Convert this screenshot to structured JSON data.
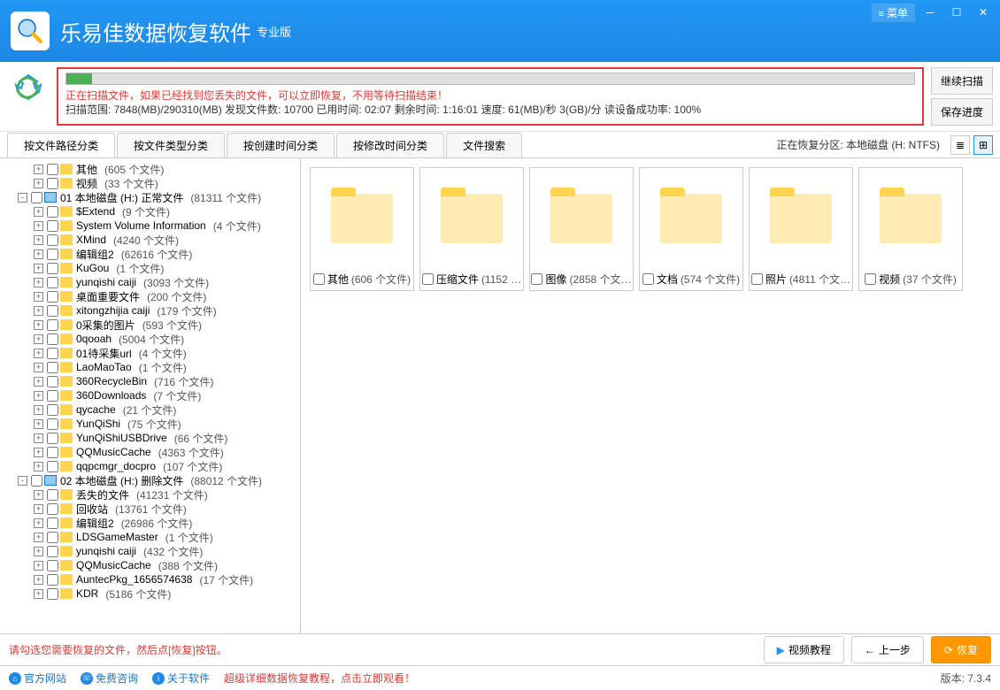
{
  "app": {
    "title": "乐易佳数据恢复软件",
    "subtitle": "专业版",
    "menu_label": "菜单"
  },
  "scan": {
    "msg1": "正在扫描文件，如果已经找到您丢失的文件，可以立即恢复，不用等待扫描结束！",
    "msg2": "扫描范围: 7848(MB)/290310(MB)  发现文件数: 10700  已用时间: 02:07  剩余时间: 1:16:01  速度: 61(MB)/秒  3(GB)/分  读设备成功率: 100%",
    "btn_continue": "继续扫描",
    "btn_save": "保存进度"
  },
  "tabs": [
    "按文件路径分类",
    "按文件类型分类",
    "按创建时间分类",
    "按修改时间分类",
    "文件搜索"
  ],
  "partition_label": "正在恢复分区: 本地磁盘 (H: NTFS)",
  "tree": [
    {
      "level": 2,
      "exp": "+",
      "type": "folder",
      "label": "其他",
      "count": "(605 个文件)"
    },
    {
      "level": 2,
      "exp": "+",
      "type": "folder",
      "label": "视频",
      "count": "(33 个文件)"
    },
    {
      "level": 1,
      "exp": "-",
      "type": "disk",
      "label": "01 本地磁盘 (H:) 正常文件",
      "count": "(81311 个文件)"
    },
    {
      "level": 2,
      "exp": "+",
      "type": "folder",
      "label": "$Extend",
      "count": "(9 个文件)"
    },
    {
      "level": 2,
      "exp": "+",
      "type": "folder",
      "label": "System Volume Information",
      "count": "(4 个文件)"
    },
    {
      "level": 2,
      "exp": "+",
      "type": "folder",
      "label": "XMind",
      "count": "(4240 个文件)"
    },
    {
      "level": 2,
      "exp": "+",
      "type": "folder",
      "label": "编辑组2",
      "count": "(62616 个文件)"
    },
    {
      "level": 2,
      "exp": "+",
      "type": "folder",
      "label": "KuGou",
      "count": "(1 个文件)"
    },
    {
      "level": 2,
      "exp": "+",
      "type": "folder",
      "label": "yunqishi caiji",
      "count": "(3093 个文件)"
    },
    {
      "level": 2,
      "exp": "+",
      "type": "folder",
      "label": "桌面重要文件",
      "count": "(200 个文件)"
    },
    {
      "level": 2,
      "exp": "+",
      "type": "folder",
      "label": "xitongzhijia caiji",
      "count": "(179 个文件)"
    },
    {
      "level": 2,
      "exp": "+",
      "type": "folder",
      "label": "0采集的图片",
      "count": "(593 个文件)"
    },
    {
      "level": 2,
      "exp": "+",
      "type": "folder",
      "label": "0qooah",
      "count": "(5004 个文件)"
    },
    {
      "level": 2,
      "exp": "+",
      "type": "folder",
      "label": "01待采集url",
      "count": "(4 个文件)"
    },
    {
      "level": 2,
      "exp": "+",
      "type": "folder",
      "label": "LaoMaoTao",
      "count": "(1 个文件)"
    },
    {
      "level": 2,
      "exp": "+",
      "type": "folder",
      "label": "360RecycleBin",
      "count": "(716 个文件)"
    },
    {
      "level": 2,
      "exp": "+",
      "type": "folder",
      "label": "360Downloads",
      "count": "(7 个文件)"
    },
    {
      "level": 2,
      "exp": "+",
      "type": "folder",
      "label": "qycache",
      "count": "(21 个文件)"
    },
    {
      "level": 2,
      "exp": "+",
      "type": "folder",
      "label": "YunQiShi",
      "count": "(75 个文件)"
    },
    {
      "level": 2,
      "exp": "+",
      "type": "folder",
      "label": "YunQiShiUSBDrive",
      "count": "(66 个文件)"
    },
    {
      "level": 2,
      "exp": "+",
      "type": "folder",
      "label": "QQMusicCache",
      "count": "(4363 个文件)"
    },
    {
      "level": 2,
      "exp": "+",
      "type": "folder",
      "label": "qqpcmgr_docpro",
      "count": "(107 个文件)"
    },
    {
      "level": 1,
      "exp": "-",
      "type": "disk",
      "label": "02 本地磁盘 (H:) 删除文件",
      "count": "(88012 个文件)"
    },
    {
      "level": 2,
      "exp": "+",
      "type": "folder",
      "label": "丢失的文件",
      "count": "(41231 个文件)"
    },
    {
      "level": 2,
      "exp": "+",
      "type": "folder",
      "label": "回收站",
      "count": "(13761 个文件)"
    },
    {
      "level": 2,
      "exp": "+",
      "type": "folder",
      "label": "编辑组2",
      "count": "(26986 个文件)"
    },
    {
      "level": 2,
      "exp": "+",
      "type": "folder",
      "label": "LDSGameMaster",
      "count": "(1 个文件)"
    },
    {
      "level": 2,
      "exp": "+",
      "type": "folder",
      "label": "yunqishi caiji",
      "count": "(432 个文件)"
    },
    {
      "level": 2,
      "exp": "+",
      "type": "folder",
      "label": "QQMusicCache",
      "count": "(388 个文件)"
    },
    {
      "level": 2,
      "exp": "+",
      "type": "folder",
      "label": "AuntecPkg_1656574638",
      "count": "(17 个文件)"
    },
    {
      "level": 2,
      "exp": "+",
      "type": "folder",
      "label": "KDR",
      "count": "(5186 个文件)"
    }
  ],
  "grid": [
    {
      "label": "其他",
      "count": "(606 个文件)"
    },
    {
      "label": "压缩文件",
      "count": "(1152 …"
    },
    {
      "label": "图像",
      "count": "(2858 个文…"
    },
    {
      "label": "文档",
      "count": "(574 个文件)"
    },
    {
      "label": "照片",
      "count": "(4811 个文…"
    },
    {
      "label": "视频",
      "count": "(37 个文件)"
    }
  ],
  "bottom": {
    "hint": "请勾选您需要恢复的文件，然后点[恢复]按钮。",
    "btn_video": "视频教程",
    "btn_prev": "上一步",
    "btn_recover": "恢复"
  },
  "footer": {
    "link_site": "官方网站",
    "link_consult": "免费咨询",
    "link_about": "关于软件",
    "tutorial": "超级详细数据恢复教程，点击立即观看！",
    "version": "版本: 7.3.4"
  }
}
